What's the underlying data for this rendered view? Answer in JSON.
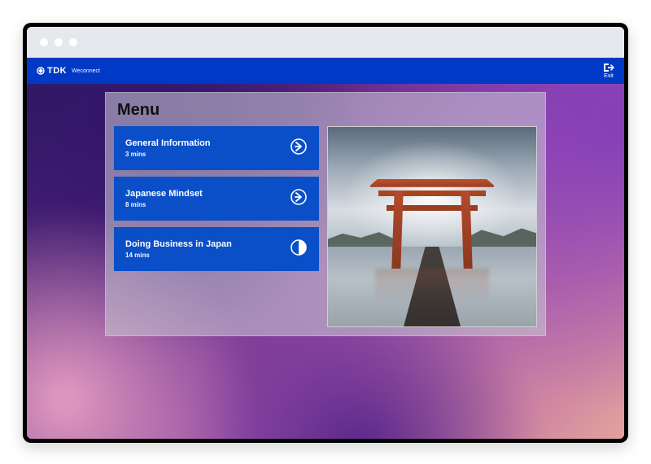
{
  "brand": {
    "logo_text": "TDK",
    "subtext": "Weconnect"
  },
  "header": {
    "exit_label": "Exit"
  },
  "menu": {
    "title": "Menu",
    "items": [
      {
        "title": "General Information",
        "duration": "3 mins",
        "status_icon": "arrow-right-circle-icon"
      },
      {
        "title": "Japanese Mindset",
        "duration": "8 mins",
        "status_icon": "arrow-right-circle-icon"
      },
      {
        "title": "Doing Business in Japan",
        "duration": "14 mins",
        "status_icon": "half-circle-icon"
      }
    ]
  },
  "colors": {
    "brand_blue": "#0039c6",
    "menu_blue": "#0a4fc7"
  }
}
